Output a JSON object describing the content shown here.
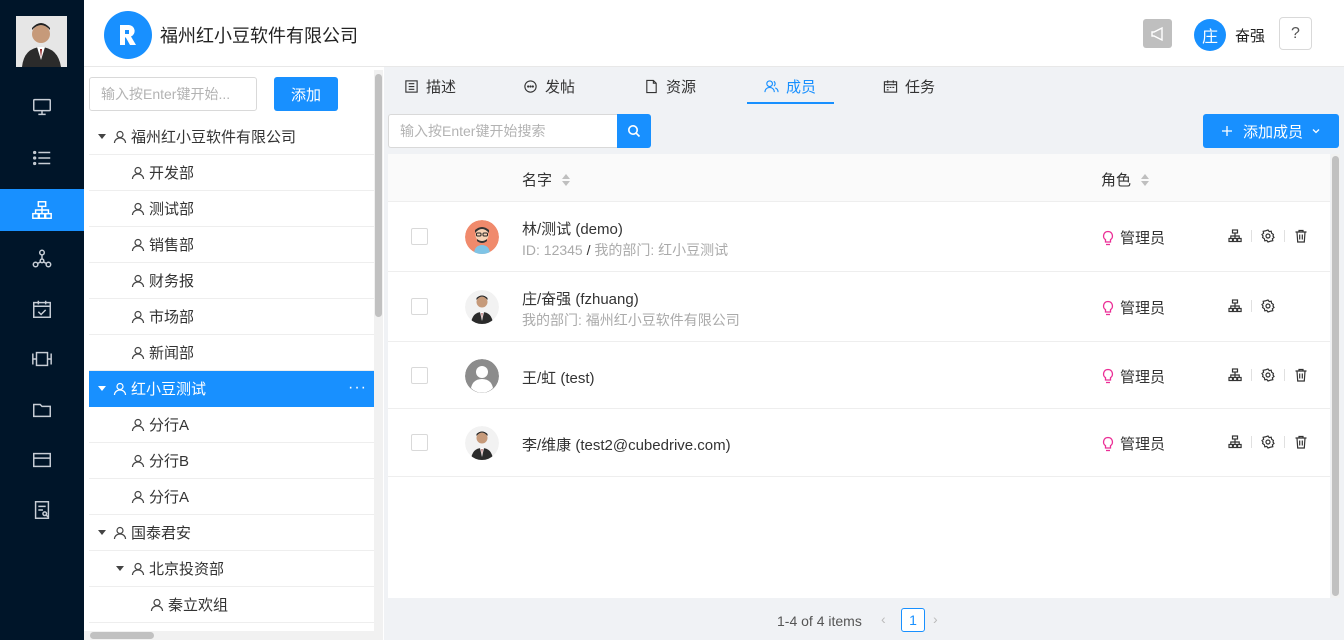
{
  "header": {
    "company_name": "福州红小豆软件有限公司",
    "user_initial": "庄",
    "user_name": "奋强",
    "help_label": "?"
  },
  "rail": {
    "items": [
      "monitor-icon",
      "list-icon",
      "org-chart-icon",
      "network-icon",
      "calendar-check-icon",
      "film-icon",
      "folder-icon",
      "card-icon",
      "report-icon"
    ],
    "active_index": 2
  },
  "tree": {
    "search_placeholder": "输入按Enter键开始...",
    "add_label": "添加",
    "more_label": "···",
    "nodes": [
      {
        "label": "福州红小豆软件有限公司",
        "level": 0,
        "expanded": true
      },
      {
        "label": "开发部",
        "level": 1
      },
      {
        "label": "测试部",
        "level": 1
      },
      {
        "label": "销售部",
        "level": 1
      },
      {
        "label": "财务报",
        "level": 1
      },
      {
        "label": "市场部",
        "level": 1
      },
      {
        "label": "新闻部",
        "level": 1
      },
      {
        "label": "红小豆测试",
        "level": 0,
        "expanded": true,
        "selected": true
      },
      {
        "label": "分行A",
        "level": 1
      },
      {
        "label": "分行B",
        "level": 1
      },
      {
        "label": "分行A",
        "level": 1
      },
      {
        "label": "国泰君安",
        "level": 0,
        "expanded": true
      },
      {
        "label": "北京投资部",
        "level": 1,
        "expanded": true
      },
      {
        "label": "秦立欢组",
        "level": 2
      }
    ]
  },
  "tabs": [
    {
      "label": "描述",
      "icon": "document-list-icon"
    },
    {
      "label": "发帖",
      "icon": "chat-bubble-icon"
    },
    {
      "label": "资源",
      "icon": "file-icon"
    },
    {
      "label": "成员",
      "icon": "members-icon",
      "active": true
    },
    {
      "label": "任务",
      "icon": "task-calendar-icon"
    }
  ],
  "members": {
    "search_placeholder": "输入按Enter键开始搜索",
    "add_label": "添加成员",
    "columns": {
      "name": "名字",
      "role": "角色"
    },
    "rows": [
      {
        "name": "林/测试 (demo)",
        "id_label": "ID: 12345",
        "slash": " / ",
        "dept_label": "我的部门: 红小豆测试",
        "role": "管理员",
        "avatar": "cartoon-avatar",
        "deletable": true
      },
      {
        "name": "庄/奋强 (fzhuang)",
        "dept_label": "我的部门: 福州红小豆软件有限公司",
        "role": "管理员",
        "avatar": "photo-avatar",
        "deletable": false
      },
      {
        "name": "王/虹 (test)",
        "role": "管理员",
        "avatar": "default-avatar",
        "deletable": true
      },
      {
        "name": "李/维康 (test2@cubedrive.com)",
        "role": "管理员",
        "avatar": "photo-avatar",
        "deletable": true
      }
    ]
  },
  "pager": {
    "info": "1-4 of 4 items",
    "prev": "‹",
    "current_page": "1",
    "next": "›"
  },
  "colors": {
    "accent": "#1890ff",
    "rail": "#001529",
    "role_icon": "#eb2f96"
  }
}
